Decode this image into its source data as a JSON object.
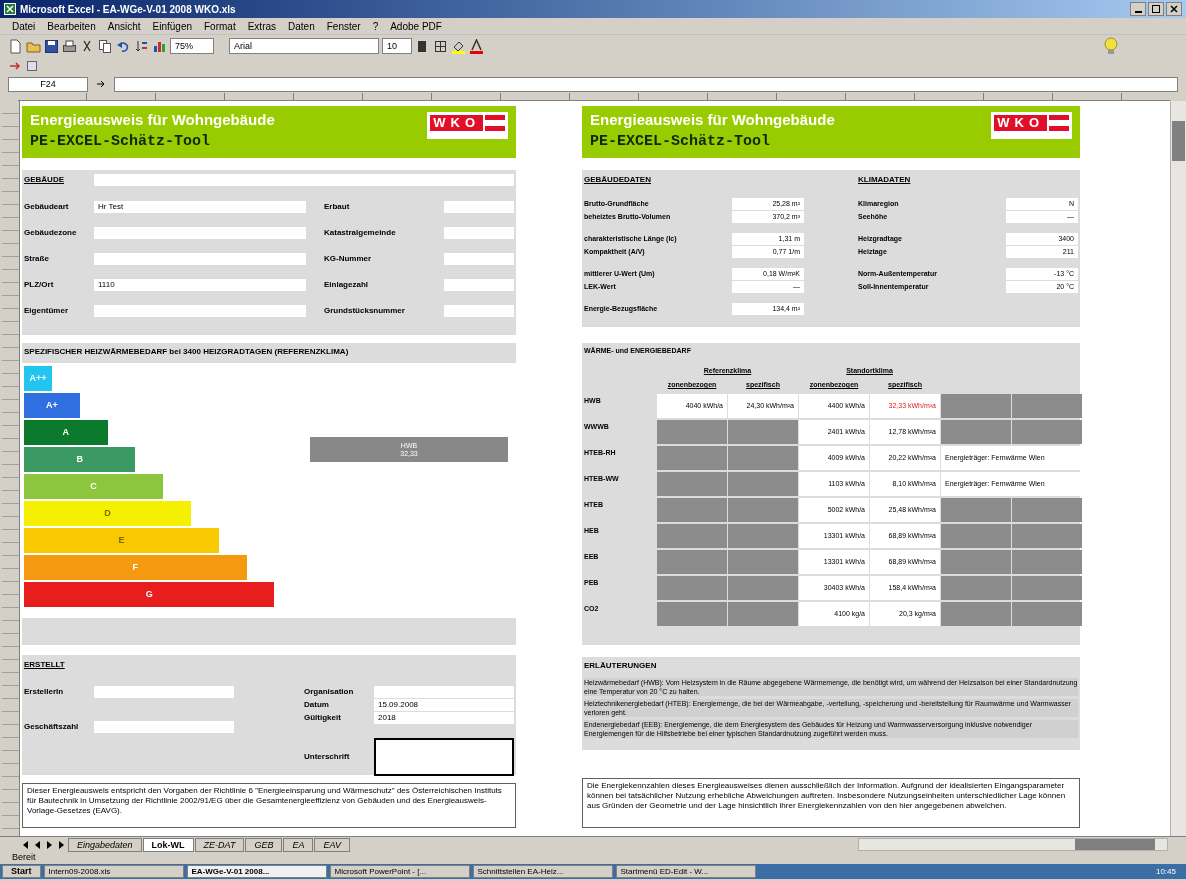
{
  "window": {
    "title": "Microsoft Excel - EA-WGe-V-01 2008 WKO.xls"
  },
  "menu": [
    "Datei",
    "Bearbeiten",
    "Ansicht",
    "Einfügen",
    "Format",
    "Extras",
    "Daten",
    "Fenster",
    "?",
    "Adobe PDF"
  ],
  "toolbar": {
    "zoom": "75%",
    "font": "Arial",
    "font_size": "10"
  },
  "name_box": "F24",
  "left_page": {
    "header": {
      "title": "Energieausweis für Wohngebäude",
      "subtitle": "PE-EXCEL-Schätz-Tool",
      "logo": "WKO"
    },
    "building": {
      "heading": "GEBÄUDE",
      "left_fields": [
        {
          "label": "Gebäudeart",
          "value": "Hr Test"
        },
        {
          "label": "Gebäudezone"
        },
        {
          "label": "Straße"
        },
        {
          "label": "PLZ/Ort",
          "value": "1110"
        },
        {
          "label": "Eigentümer"
        }
      ],
      "right_fields": [
        {
          "label": "Erbaut"
        },
        {
          "label": "Katastralgemeinde"
        },
        {
          "label": "KG-Nummer"
        },
        {
          "label": "Einlagezahl"
        },
        {
          "label": "Grundstücksnummer"
        }
      ]
    },
    "scale": {
      "heading": "SPEZIFISCHER HEIZWÄRMEBEDARF bei 3400 HEIZGRADTAGEN (REFERENZKLIMA)",
      "classes": [
        {
          "label": "A++",
          "color": "#22c4f0"
        },
        {
          "label": "A+",
          "color": "#2f6fe0"
        },
        {
          "label": "A",
          "color": "#0b7a2c"
        },
        {
          "label": "B",
          "color": "#3a9a62"
        },
        {
          "label": "C",
          "color": "#8cc63e"
        },
        {
          "label": "D",
          "color": "#f5f000"
        },
        {
          "label": "E",
          "color": "#f8c800"
        },
        {
          "label": "F",
          "color": "#f59a10"
        },
        {
          "label": "G",
          "color": "#e81e1e"
        }
      ],
      "indicator": [
        "HWB",
        "32,33"
      ]
    },
    "creator": {
      "heading": "ERSTELLT",
      "left_fields": [
        {
          "label": "ErstellerIn"
        },
        {
          "label": "Geschäftszahl"
        }
      ],
      "right_fields": [
        {
          "label": "Organisation"
        },
        {
          "label": "Datum",
          "value": "15.09.2008"
        },
        {
          "label": "Gültigkeit",
          "value": "2018"
        }
      ],
      "signature": "Unterschrift"
    },
    "footnote": "Dieser Energieausweis entspricht den Vorgaben der Richtlinie 6 \"Energieeinsparung und Wärmeschutz\" des Österreichischen Instituts für Bautechnik in Umsetzung der Richtlinie 2002/91/EG über die Gesamtenergieeffizienz von Gebäuden und des Energieausweis-Vorlage-Gesetzes (EAVG)."
  },
  "right_page": {
    "header": {
      "title": "Energieausweis für Wohngebäude",
      "subtitle": "PE-EXCEL-Schätz-Tool",
      "logo": "WKO"
    },
    "building_data": {
      "heading": "GEBÄUDEDATEN",
      "groups": [
        [
          {
            "label": "Brutto-Grundfläche",
            "value": "25,28 m²"
          },
          {
            "label": "beheiztes Brutto-Volumen",
            "value": "370,2 m³"
          }
        ],
        [
          {
            "label": "charakteristische Länge (lc)",
            "value": "1,31 m"
          },
          {
            "label": "Kompaktheit (A/V)",
            "value": "0,77 1/m"
          }
        ],
        [
          {
            "label": "mittlerer U-Wert (Um)",
            "value": "0,18 W/m²K"
          },
          {
            "label": "LEK-Wert",
            "value": "—"
          }
        ],
        [
          {
            "label": "Energie-Bezugsfläche",
            "value": "134,4 m²"
          }
        ]
      ]
    },
    "climate_data": {
      "heading": "KLIMADATEN",
      "groups": [
        [
          {
            "label": "Klimaregion",
            "value": "N"
          },
          {
            "label": "Seehöhe",
            "value": "—"
          }
        ],
        [
          {
            "label": "Heizgradtage",
            "value": "3400"
          },
          {
            "label": "Heiztage",
            "value": "211"
          }
        ],
        [
          {
            "label": "Norm-Außentemperatur",
            "value": "-13 °C"
          },
          {
            "label": "Soll-Innentemperatur",
            "value": "20 °C"
          }
        ]
      ]
    },
    "energy": {
      "heading": "WÄRME- und ENERGIEBEDARF",
      "groups": [
        {
          "label": "Referenzklima",
          "columns": [
            "zonenbezogen",
            "spezifisch"
          ]
        },
        {
          "label": "Standortklima",
          "columns": [
            "zonenbezogen",
            "spezifisch"
          ]
        }
      ],
      "rows": [
        {
          "label": "HWB",
          "reference": [
            "4040 kWh/a",
            "24,30 kWh/m²a"
          ],
          "site": [
            "4400 kWh/a",
            "32,33 kWh/m²a"
          ],
          "site_alert": true
        },
        {
          "label": "WWWB",
          "site": [
            "2401 kWh/a",
            "12,78 kWh/m²a"
          ],
          "site_alert": false
        },
        {
          "label": "HTEB-RH",
          "site": [
            "4009 kWh/a",
            "20,22 kWh/m²a"
          ],
          "site_alert": false,
          "note": "Energieträger: Fernwärme Wien"
        },
        {
          "label": "HTEB-WW",
          "site": [
            "1103 kWh/a",
            "8,10 kWh/m²a"
          ],
          "site_alert": false,
          "note": "Energieträger: Fernwärme Wien"
        },
        {
          "label": "HTEB",
          "site": [
            "5002 kWh/a",
            "25,48 kWh/m²a"
          ],
          "site_alert": false
        },
        {
          "label": "HEB",
          "site": [
            "13301 kWh/a",
            "68,89 kWh/m²a"
          ],
          "site_alert": false
        },
        {
          "label": "EEB",
          "site": [
            "13301 kWh/a",
            "68,89 kWh/m²a"
          ],
          "site_alert": false
        },
        {
          "label": "PEB",
          "site": [
            "30403 kWh/a",
            "158,4 kWh/m²a"
          ],
          "site_alert": false
        },
        {
          "label": "CO2",
          "site": [
            "4100 kg/a",
            "20,3 kg/m²a"
          ],
          "site_alert": false
        }
      ]
    },
    "notes": {
      "heading": "ERLÄUTERUNGEN",
      "paragraphs": [
        "Heizwärmebedarf (HWB): Vom Heizsystem in die Räume abgegebene Wärmemenge, die benötigt wird, um während der Heizsaison bei einer Standardnutzung eine Temperatur von 20 °C zu halten.",
        "Heiztechnikenergiebedarf (HTEB): Energiemenge, die bei der Wärmeabgabe, -verteilung, -speicherung und -bereitstellung für Raumwärme und Warmwasser verloren geht.",
        "Endenergiebedarf (EEB): Energiemenge, die dem Energiesystem des Gebäudes für Heizung und Warmwasserversorgung inklusive notwendiger Energiemengen für die Hilfsbetriebe bei einer typischen Standardnutzung zugeführt werden muss."
      ]
    },
    "footnote": "Die Energiekennzahlen dieses Energieausweises dienen ausschließlich der Information. Aufgrund der idealisierten Eingangsparameter können bei tatsächlicher Nutzung erhebliche Abweichungen auftreten. Insbesondere Nutzungseinheiten unterschiedlicher Lage können aus Gründen der Geometrie und der Lage hinsichtlich ihrer Energiekennzahlen von den hier angegebenen abweichen."
  },
  "sheet_tabs": [
    {
      "label": "Eingabedaten",
      "selected": false
    },
    {
      "label": "Lok-WL",
      "selected": true
    },
    {
      "label": "ZE-DAT",
      "selected": false
    },
    {
      "label": "GEB",
      "selected": false
    },
    {
      "label": "EA",
      "selected": false
    },
    {
      "label": "EAV",
      "selected": false
    }
  ],
  "status": "Bereit",
  "taskbar": {
    "start": "Start",
    "items": [
      {
        "label": "Intern09-2008.xls",
        "selected": false
      },
      {
        "label": "EA-WGe-V-01 2008...",
        "selected": true
      },
      {
        "label": "Microsoft PowerPoint - [...",
        "selected": false
      },
      {
        "label": "Schnittstellen EA-Heiz...",
        "selected": false
      },
      {
        "label": "Startmenü ED-Edit - W...",
        "selected": false
      }
    ],
    "clock": "10:45"
  }
}
